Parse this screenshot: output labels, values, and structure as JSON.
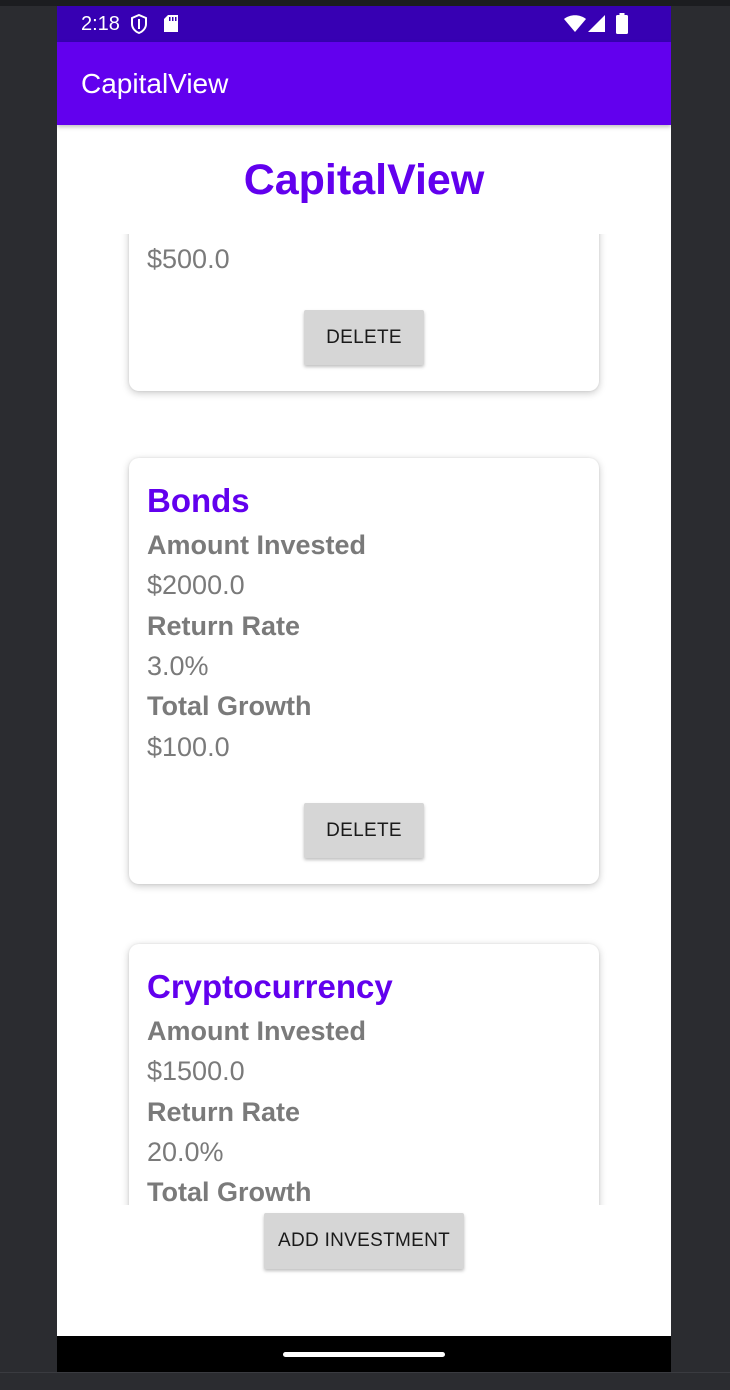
{
  "status_bar": {
    "time": "2:18",
    "icons": [
      "shield-icon",
      "sd-card-icon",
      "wifi-icon",
      "signal-icon",
      "battery-icon"
    ]
  },
  "app_bar": {
    "title": "CapitalView"
  },
  "page": {
    "title": "CapitalView"
  },
  "colors": {
    "status_bar": "#3700b3",
    "primary": "#6200ee",
    "text_gray": "#7a7a7a",
    "button_bg": "#d6d6d6"
  },
  "investments": [
    {
      "name": "",
      "visible_value": "$500.0",
      "delete_label": "DELETE"
    },
    {
      "name": "Bonds",
      "amount_label": "Amount Invested",
      "amount": "$2000.0",
      "rate_label": "Return Rate",
      "rate": "3.0%",
      "growth_label": "Total Growth",
      "growth": "$100.0",
      "delete_label": "DELETE"
    },
    {
      "name": "Cryptocurrency",
      "amount_label": "Amount Invested",
      "amount": "$1500.0",
      "rate_label": "Return Rate",
      "rate": "20.0%",
      "growth_label": "Total Growth"
    }
  ],
  "add_button_label": "ADD INVESTMENT"
}
